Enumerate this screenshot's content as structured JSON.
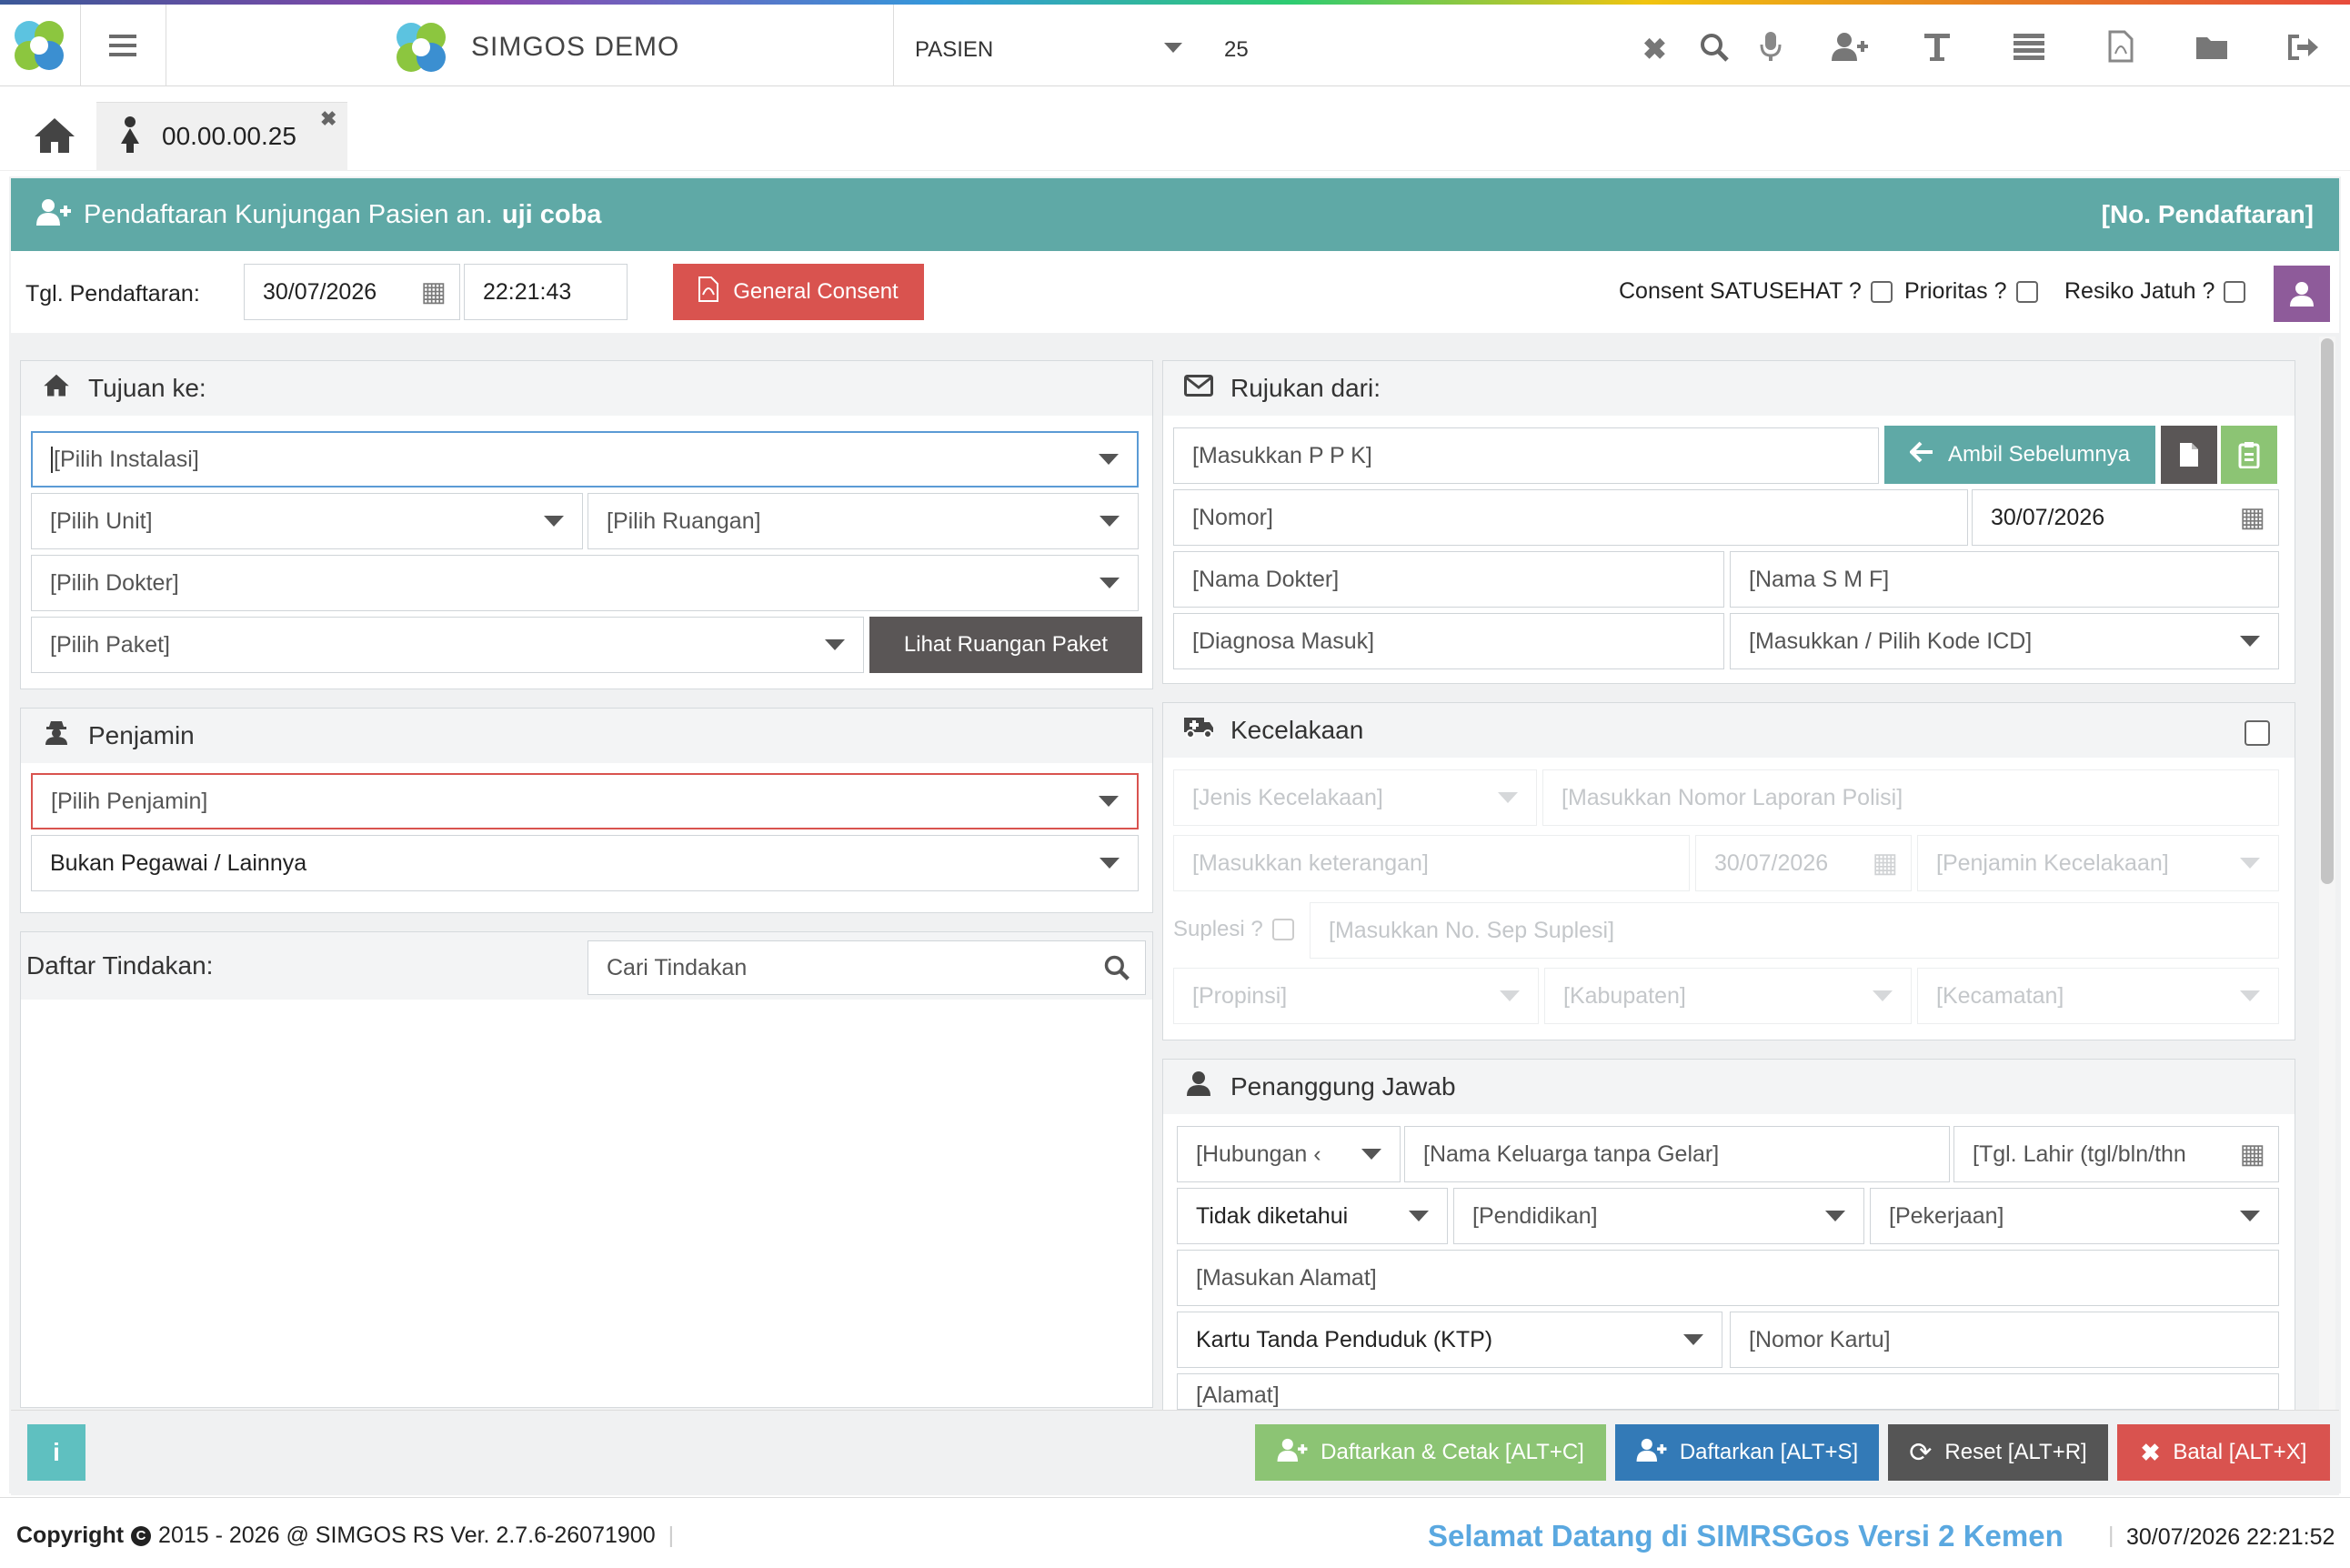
{
  "app": {
    "title": "SIMGOS DEMO"
  },
  "search": {
    "category": "PASIEN",
    "value": "25"
  },
  "tab": {
    "label": "00.00.00.25"
  },
  "form_header": {
    "prefix": "Pendaftaran Kunjungan Pasien an.",
    "patient": "uji coba",
    "reg_no": "[No. Pendaftaran]"
  },
  "registration": {
    "label": "Tgl. Pendaftaran:",
    "date": "30/07/2026",
    "time": "22:21:43",
    "consent_button": "General Consent"
  },
  "flags": {
    "consent": "Consent SATUSEHAT ?",
    "prioritas": "Prioritas ?",
    "resiko": "Resiko Jatuh ?"
  },
  "tujuan": {
    "title": "Tujuan ke:",
    "instalasi": "[Pilih Instalasi]",
    "unit": "[Pilih Unit]",
    "ruangan": "[Pilih Ruangan]",
    "dokter": "[Pilih Dokter]",
    "paket": "[Pilih Paket]",
    "lihat_button": "Lihat Ruangan Paket"
  },
  "penjamin": {
    "title": "Penjamin",
    "select": "[Pilih Penjamin]",
    "status": "Bukan Pegawai / Lainnya"
  },
  "tindakan": {
    "title": "Daftar Tindakan:",
    "search_placeholder": "Cari Tindakan"
  },
  "rujukan": {
    "title": "Rujukan dari:",
    "ppk": "[Masukkan P P K]",
    "ambil_button": "Ambil Sebelumnya",
    "nomor": "[Nomor]",
    "date": "30/07/2026",
    "dokter": "[Nama Dokter]",
    "smf": "[Nama S M F]",
    "diagnosa": "[Diagnosa Masuk]",
    "icd": "[Masukkan / Pilih Kode ICD]"
  },
  "kecelakaan": {
    "title": "Kecelakaan",
    "jenis": "[Jenis Kecelakaan]",
    "laporan": "[Masukkan Nomor Laporan Polisi]",
    "keterangan": "[Masukkan keterangan]",
    "date": "30/07/2026",
    "penjamin": "[Penjamin Kecelakaan]",
    "suplesi": "Suplesi ?",
    "sep": "[Masukkan No. Sep Suplesi]",
    "propinsi": "[Propinsi]",
    "kabupaten": "[Kabupaten]",
    "kecamatan": "[Kecamatan]"
  },
  "pj": {
    "title": "Penanggung Jawab",
    "hubungan": "[Hubungan ‹",
    "nama": "[Nama Keluarga tanpa Gelar]",
    "tgl_lahir": "[Tgl. Lahir (tgl/bln/thn",
    "jk": "Tidak diketahui",
    "pendidikan": "[Pendidikan]",
    "pekerjaan": "[Pekerjaan]",
    "alamat": "[Masukan Alamat]",
    "kartu": "Kartu Tanda Penduduk (KTP)",
    "nomor_kartu": "[Nomor Kartu]",
    "alamat2": "[Alamat]"
  },
  "actions": {
    "daftar_cetak": "Daftarkan & Cetak [ALT+C]",
    "daftar": "Daftarkan [ALT+S]",
    "reset": "Reset [ALT+R]",
    "batal": "Batal [ALT+X]"
  },
  "footer": {
    "copyright_label": "Copyright",
    "copyright_text": "2015 - 2026 @ SIMGOS RS Ver. 2.7.6-26071900",
    "marquee": "Selamat Datang di SIMRSGos Versi 2 Kemen",
    "datetime": "30/07/2026 22:21:52"
  },
  "colors": {
    "teal": "#5fa9a6",
    "red": "#d9534f",
    "green": "#8cc474",
    "blue": "#337ab7",
    "dark": "#555555",
    "purple": "#8e5b9a"
  }
}
